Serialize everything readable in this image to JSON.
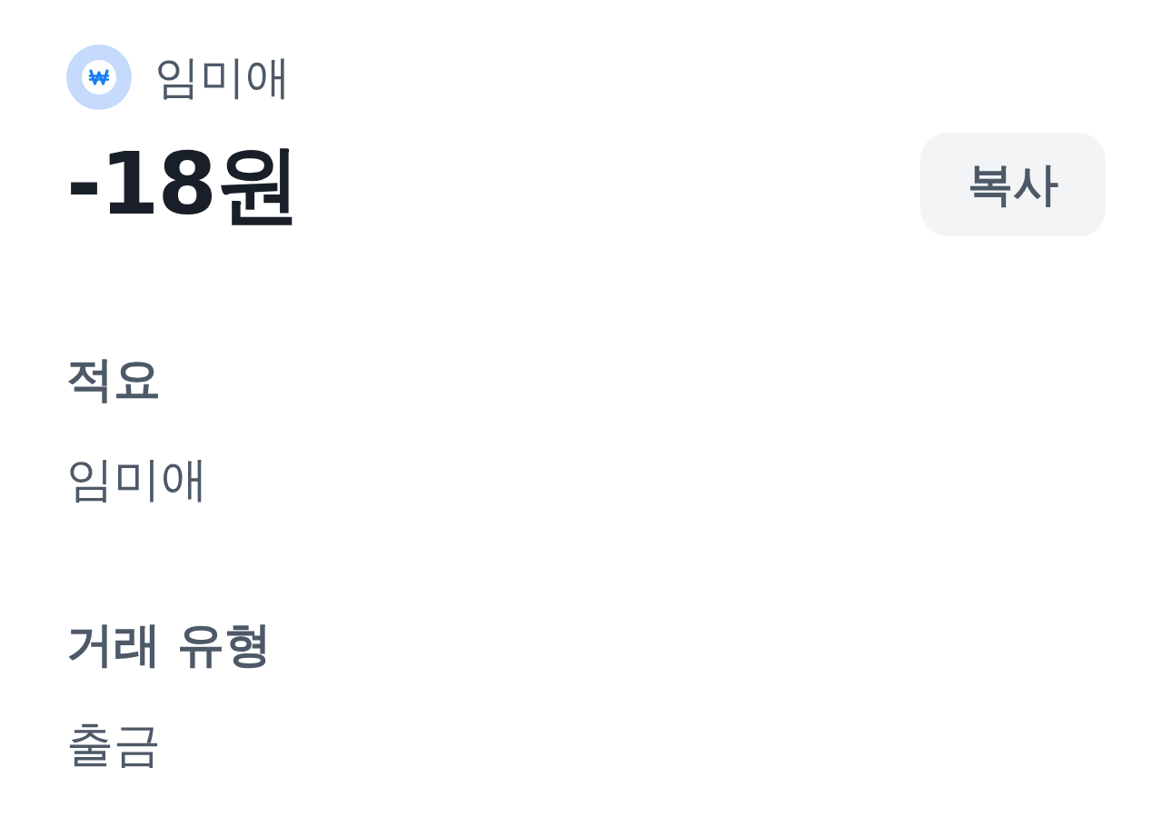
{
  "account": {
    "name": "임미애"
  },
  "amount": "-18원",
  "copy_button": {
    "label": "복사"
  },
  "details": [
    {
      "label": "적요",
      "value": "임미애"
    },
    {
      "label": "거래 유형",
      "value": "출금"
    }
  ]
}
